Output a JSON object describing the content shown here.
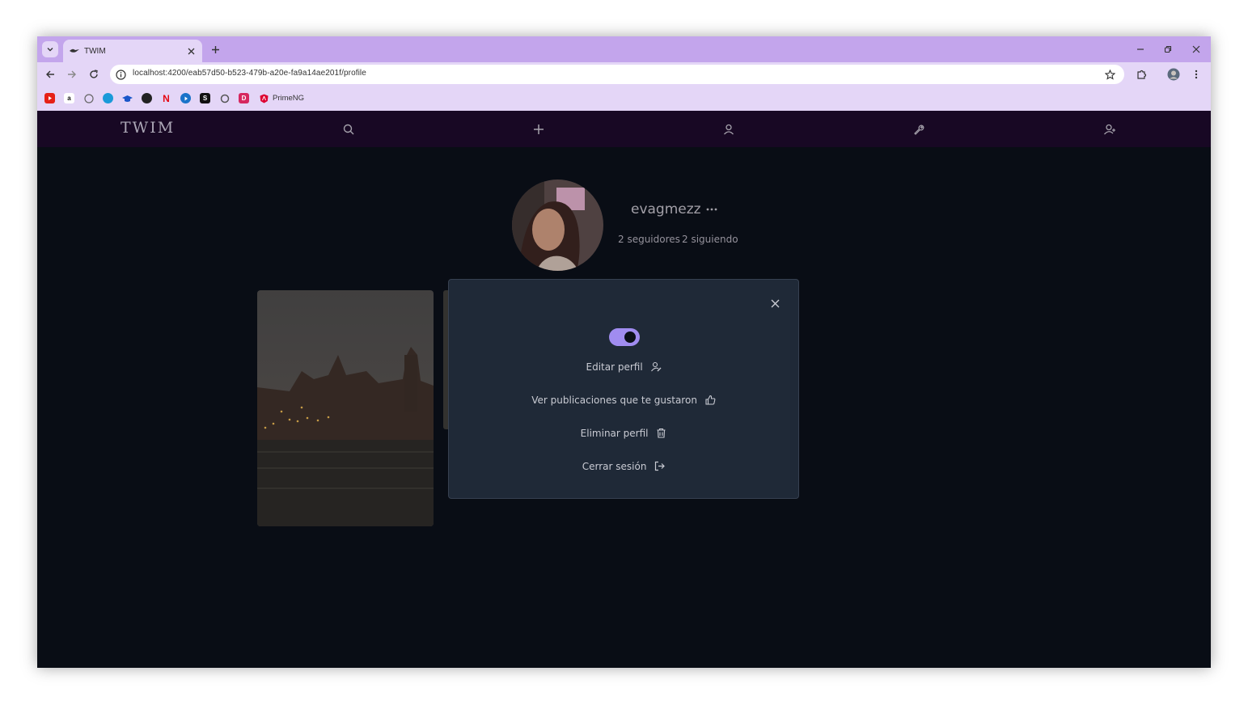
{
  "browser": {
    "tab_title": "TWIM",
    "url": "localhost:4200/eab57d50-b523-479b-a20e-fa9a14ae201f/profile",
    "bookmarks": [
      {
        "icon": "youtube-icon",
        "color": "#e62117"
      },
      {
        "icon": "amazon-icon",
        "color": "#ffffff"
      },
      {
        "icon": "github-icon",
        "color": "#ffffff"
      },
      {
        "icon": "globe-icon",
        "color": "#1a9ad9"
      },
      {
        "icon": "graduation-cap-icon",
        "color": "#1a56c9"
      },
      {
        "icon": "bookmark-dark-icon",
        "color": "#222222"
      },
      {
        "icon": "netflix-icon",
        "color": "#e50914"
      },
      {
        "icon": "play-icon",
        "color": "#1a73c9"
      },
      {
        "icon": "s-icon",
        "color": "#111111"
      },
      {
        "icon": "chatgpt-icon",
        "color": "#555555"
      },
      {
        "icon": "d-icon",
        "color": "#d6275f"
      },
      {
        "icon": "primeng-icon",
        "color": "#dd0031"
      }
    ],
    "bookmark_label": "PrimeNG",
    "accent": "#c3a5ec",
    "toolbar_bg": "#e4d6f7"
  },
  "app": {
    "brand": "TWIM",
    "nav_icons": [
      "search-icon",
      "plus-icon",
      "user-icon",
      "wrench-icon",
      "user-plus-icon"
    ],
    "nav_bg": "#1c0a2a",
    "bg": "#0b0f19"
  },
  "profile": {
    "username": "evagmezz",
    "followers": "2 seguidores",
    "following": "2 siguiendo"
  },
  "dialog": {
    "toggle_on": true,
    "toggle_color": "#a08cf0",
    "items": [
      {
        "label": "Editar perfil",
        "icon": "user-edit-icon"
      },
      {
        "label": "Ver publicaciones que te gustaron",
        "icon": "thumbs-up-icon"
      },
      {
        "label": "Eliminar perfil",
        "icon": "trash-icon"
      },
      {
        "label": "Cerrar sesión",
        "icon": "sign-out-icon"
      }
    ]
  }
}
